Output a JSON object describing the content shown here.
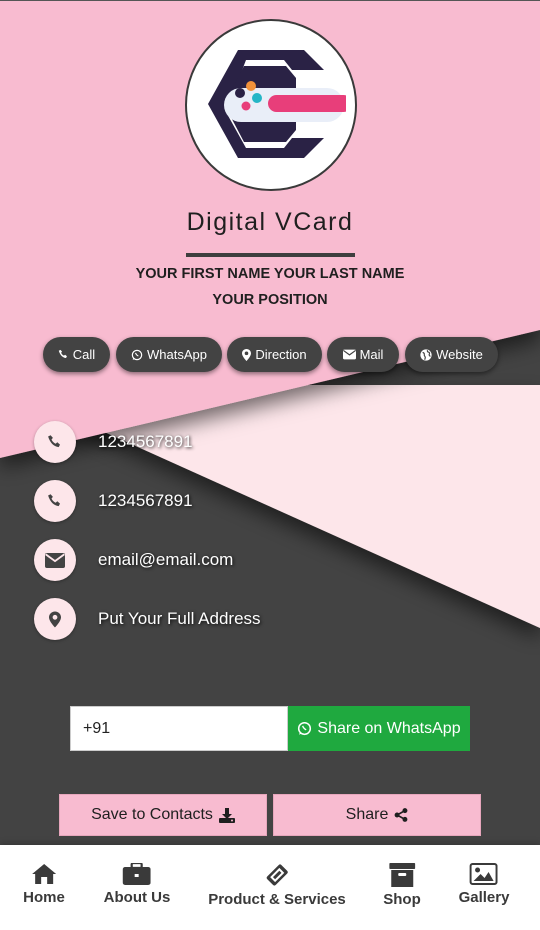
{
  "brand": {
    "title": "Digital VCard"
  },
  "profile": {
    "name": "YOUR FIRST NAME YOUR LAST NAME",
    "position": "YOUR POSITION"
  },
  "actions": [
    {
      "label": "Call",
      "icon": "phone-icon"
    },
    {
      "label": "WhatsApp",
      "icon": "whatsapp-icon"
    },
    {
      "label": "Direction",
      "icon": "map-marker-icon"
    },
    {
      "label": "Mail",
      "icon": "envelope-icon"
    },
    {
      "label": "Website",
      "icon": "globe-icon"
    }
  ],
  "contacts": [
    {
      "type": "phone",
      "value": "1234567891",
      "icon": "phone-icon"
    },
    {
      "type": "phone",
      "value": "1234567891",
      "icon": "phone-icon"
    },
    {
      "type": "email",
      "value": "email@email.com",
      "icon": "envelope-icon"
    },
    {
      "type": "address",
      "value": "Put Your Full Address",
      "icon": "map-marker-icon"
    }
  ],
  "whatsapp_share": {
    "input_value": "+91",
    "button_label": "Share on WhatsApp"
  },
  "buttons": {
    "save_contacts": "Save to Contacts",
    "share": "Share"
  },
  "nav": [
    {
      "label": "Home",
      "icon": "home-icon"
    },
    {
      "label": "About Us",
      "icon": "briefcase-icon"
    },
    {
      "label": "Product & Services",
      "icon": "ticket-icon"
    },
    {
      "label": "Shop",
      "icon": "archive-icon"
    },
    {
      "label": "Gallery",
      "icon": "image-icon"
    }
  ],
  "colors": {
    "pink": "#f8bbd0",
    "light_pink": "#fde6ea",
    "dark": "#434343",
    "whatsapp_green": "#1fa93f",
    "logo_navy": "#2a2245",
    "logo_pink": "#e83e7a"
  }
}
